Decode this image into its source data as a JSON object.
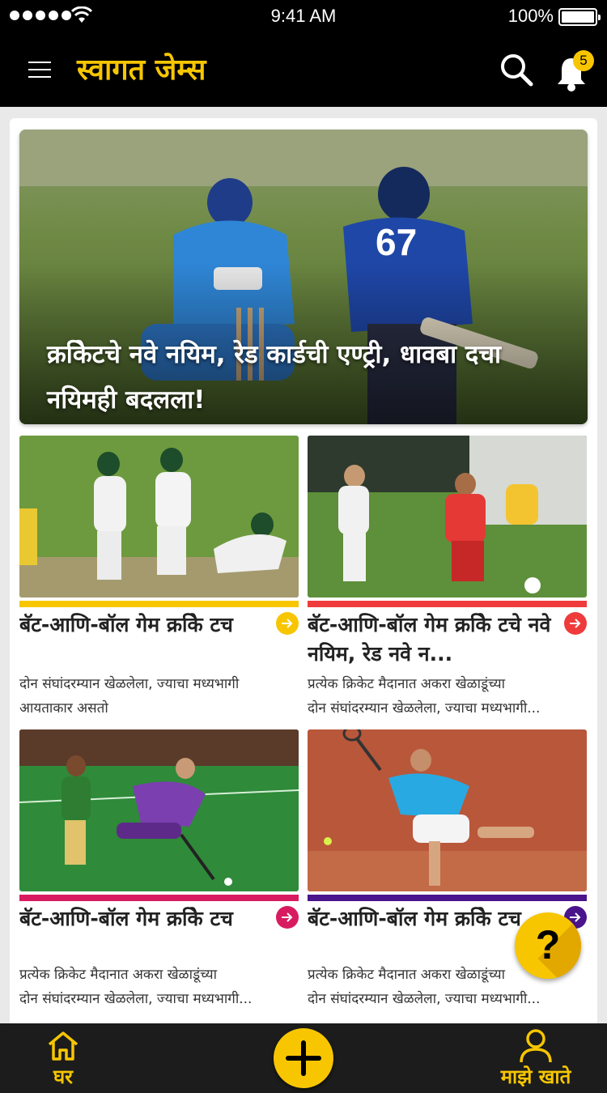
{
  "status_bar": {
    "time": "9:41 AM",
    "battery": "100%"
  },
  "header": {
    "title": "स्वागत जेम्स",
    "notification_count": "5",
    "icons": [
      "menu-icon",
      "search-icon",
      "bell-icon"
    ]
  },
  "hero": {
    "title": "क्रकिेटचे नवे नयिम, रेड कार्डची एण्ट्री, धावबा दचा नयिमही बदलला!",
    "image": "cricket-wicketkeeper-photo"
  },
  "tiles": [
    {
      "title": "बॅट-आणि-बॉल गेम क्रकिे टच",
      "description_line1": "दोन संघांदरम्यान खेळलेला, ज्याचा मध्यभागी",
      "description_line2": "आयताकार असतो",
      "accent_color": "#f7c600",
      "image": "cricket-batting-photo"
    },
    {
      "title": "बॅट-आणि-बॉल गेम क्रकिे टचे नवे नयिम, रेड नवे न...",
      "description_line1": "प्रत्येक क्रिकेट मैदानात अकरा खेळाडूंच्या",
      "description_line2": "दोन संघांदरम्यान खेळलेला, ज्याचा मध्यभागी...",
      "accent_color": "#ef3b3b",
      "image": "football-photo"
    },
    {
      "title": "बॅट-आणि-बॉल गेम क्रकिे टच",
      "description_line1": "प्रत्येक क्रिकेट मैदानात अकरा खेळाडूंच्या",
      "description_line2": "दोन संघांदरम्यान खेळलेला, ज्याचा मध्यभागी...",
      "accent_color": "#d81b60",
      "image": "hockey-photo"
    },
    {
      "title": "बॅट-आणि-बॉल गेम क्रकिे टच",
      "description_line1": "प्रत्येक क्रिकेट मैदानात अकरा खेळाडूंच्या",
      "description_line2": "दोन संघांदरम्यान खेळलेला, ज्याचा मध्यभागी...",
      "accent_color": "#4a148c",
      "image": "tennis-photo"
    }
  ],
  "help_button": {
    "label": "?"
  },
  "bottom_nav": {
    "home_label": "घर",
    "account_label": "माझे खाते",
    "icons": [
      "home-icon",
      "add-icon",
      "user-icon"
    ]
  },
  "colors": {
    "brand": "#f7c600",
    "header_bg": "#000000",
    "nav_bg": "#1c1c1c"
  }
}
